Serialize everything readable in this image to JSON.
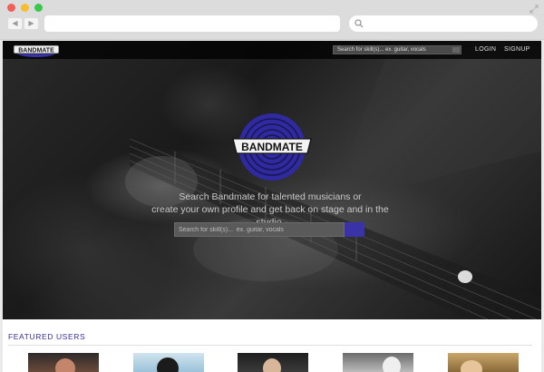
{
  "brand": {
    "name": "BANDMATE",
    "accent": "#3a33a8"
  },
  "nav": {
    "search_placeholder": "Search for skill(s)...  ex. guitar, vocals",
    "login": "LOGIN",
    "signup": "SIGNUP"
  },
  "hero": {
    "logo_text": "BANDMATE",
    "tagline_line1": "Search Bandmate for talented musicians or",
    "tagline_line2": "create your own profile and get back on stage and in the studio.",
    "search_placeholder": "Search for skill(s)...  ex. guitar, vocals"
  },
  "featured": {
    "title": "FEATURED  USERS"
  }
}
